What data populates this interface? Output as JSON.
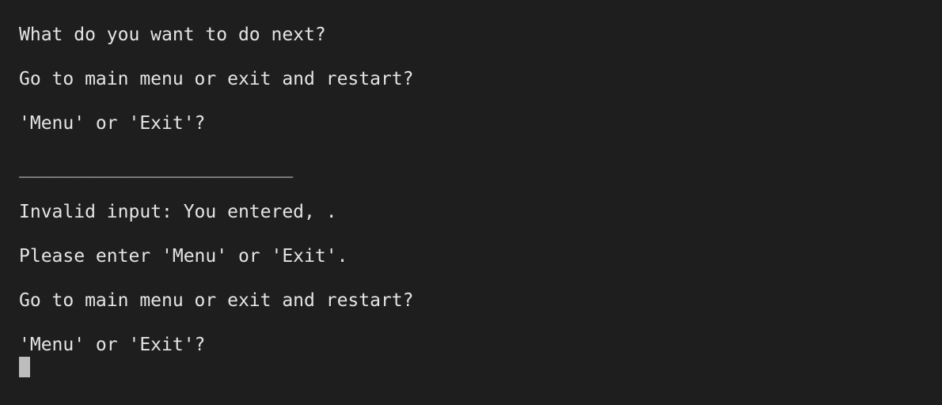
{
  "terminal": {
    "lines": [
      "What do you want to do next?",
      "Go to main menu or exit and restart?",
      "'Menu' or 'Exit'?",
      "_________________________",
      "Invalid input: You entered, .",
      "Please enter 'Menu' or 'Exit'.",
      "Go to main menu or exit and restart?",
      "'Menu' or 'Exit'?"
    ],
    "colors": {
      "background": "#1e1e1e",
      "text": "#e4e4e4",
      "cursor": "#bdbdbd"
    }
  }
}
